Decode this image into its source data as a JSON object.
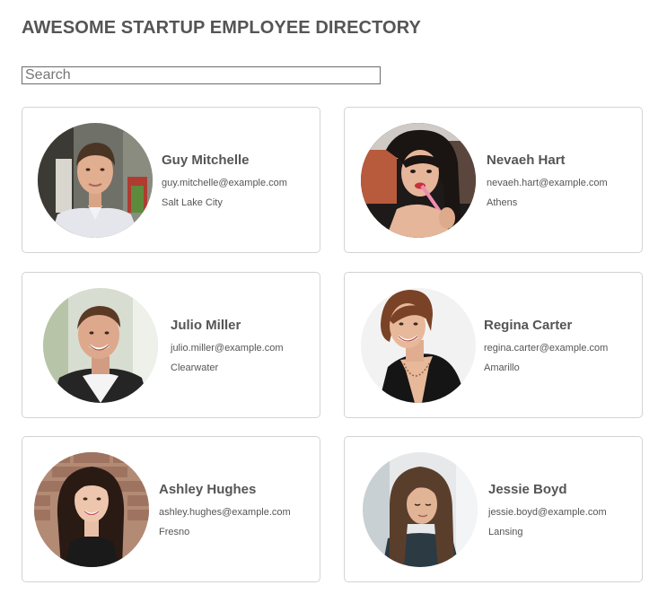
{
  "page": {
    "title": "AWESOME STARTUP EMPLOYEE DIRECTORY"
  },
  "search": {
    "placeholder": "Search",
    "value": ""
  },
  "employees": [
    {
      "name": "Guy Mitchelle",
      "email": "guy.mitchelle@example.com",
      "city": "Salt Lake City"
    },
    {
      "name": "Nevaeh Hart",
      "email": "nevaeh.hart@example.com",
      "city": "Athens"
    },
    {
      "name": "Julio Miller",
      "email": "julio.miller@example.com",
      "city": "Clearwater"
    },
    {
      "name": "Regina Carter",
      "email": "regina.carter@example.com",
      "city": "Amarillo"
    },
    {
      "name": "Ashley Hughes",
      "email": "ashley.hughes@example.com",
      "city": "Fresno"
    },
    {
      "name": "Jessie Boyd",
      "email": "jessie.boyd@example.com",
      "city": "Lansing"
    }
  ]
}
